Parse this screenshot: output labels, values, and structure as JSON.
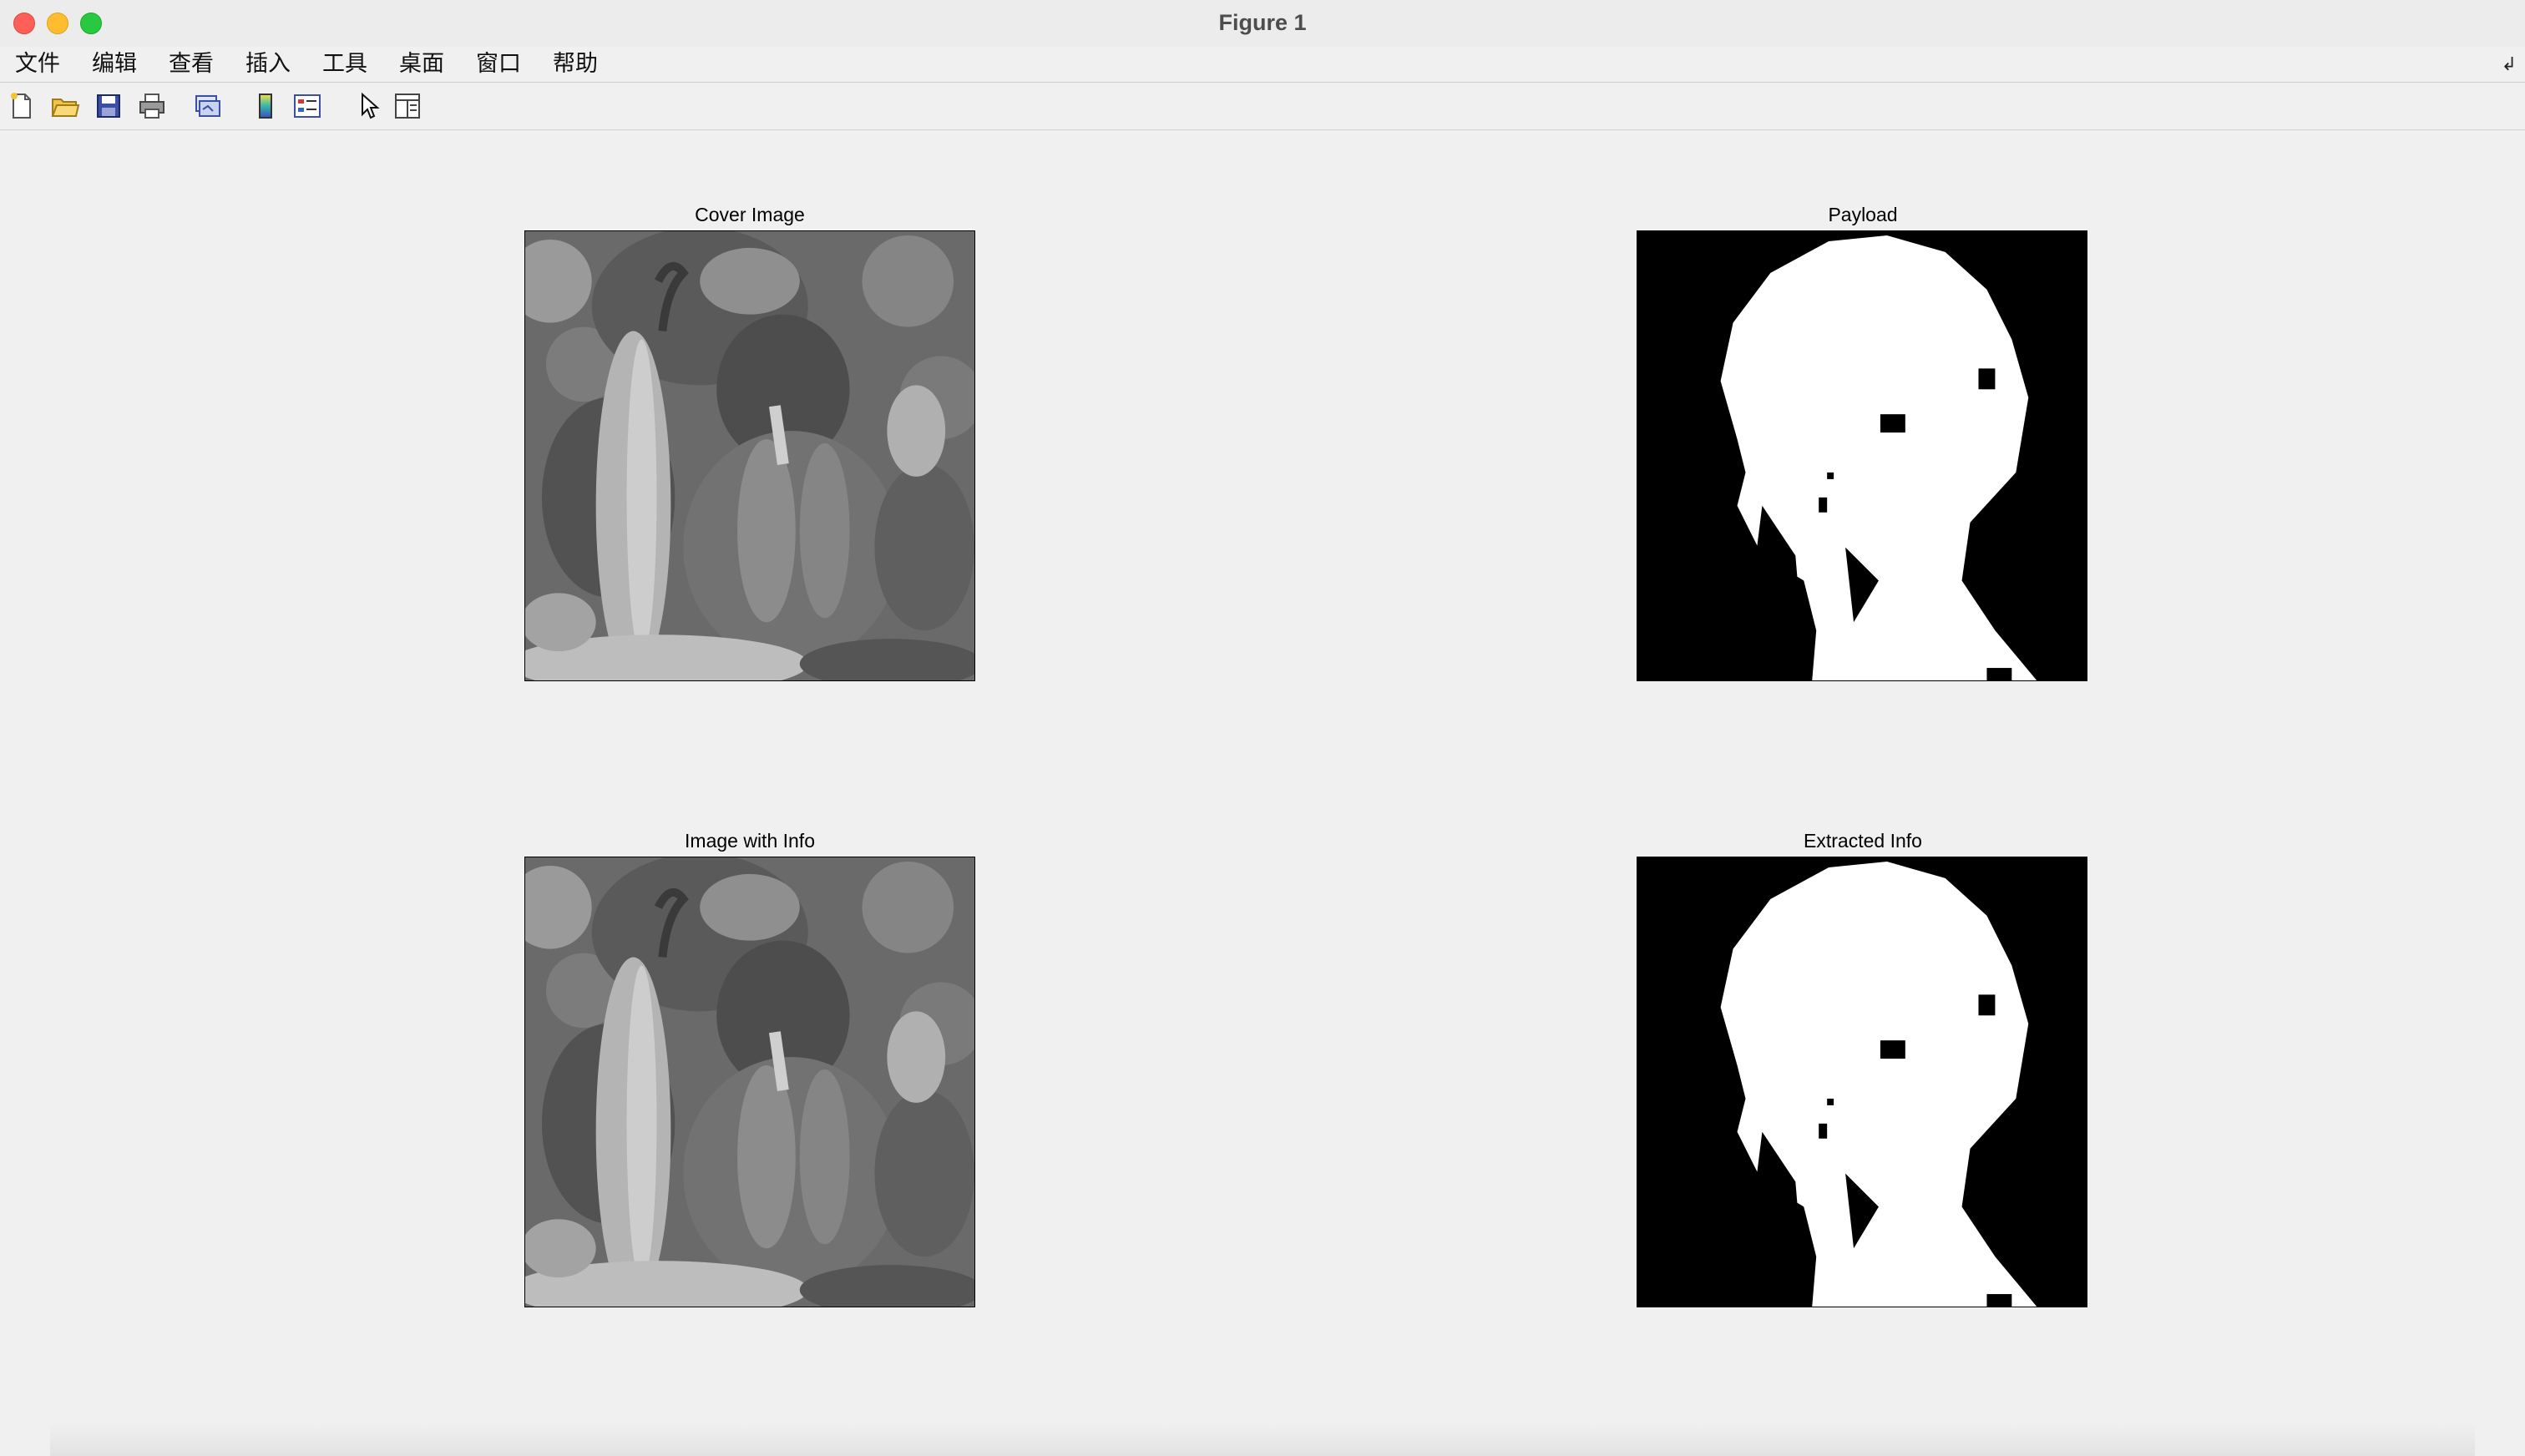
{
  "window": {
    "title": "Figure 1"
  },
  "menu": {
    "items": [
      "文件",
      "编辑",
      "查看",
      "插入",
      "工具",
      "桌面",
      "窗口",
      "帮助"
    ]
  },
  "toolbar": {
    "buttons": [
      "new-figure-icon",
      "open-file-icon",
      "save-icon",
      "print-icon",
      "link-figure-icon",
      "colorbar-icon",
      "legend-icon",
      "edit-plot-arrow-icon",
      "property-inspector-icon"
    ]
  },
  "figure": {
    "subplots": [
      {
        "title": "Cover Image",
        "kind": "grayscale-photo"
      },
      {
        "title": "Payload",
        "kind": "binary-image"
      },
      {
        "title": "Image with Info",
        "kind": "grayscale-photo"
      },
      {
        "title": "Extracted Info",
        "kind": "binary-image"
      }
    ]
  }
}
